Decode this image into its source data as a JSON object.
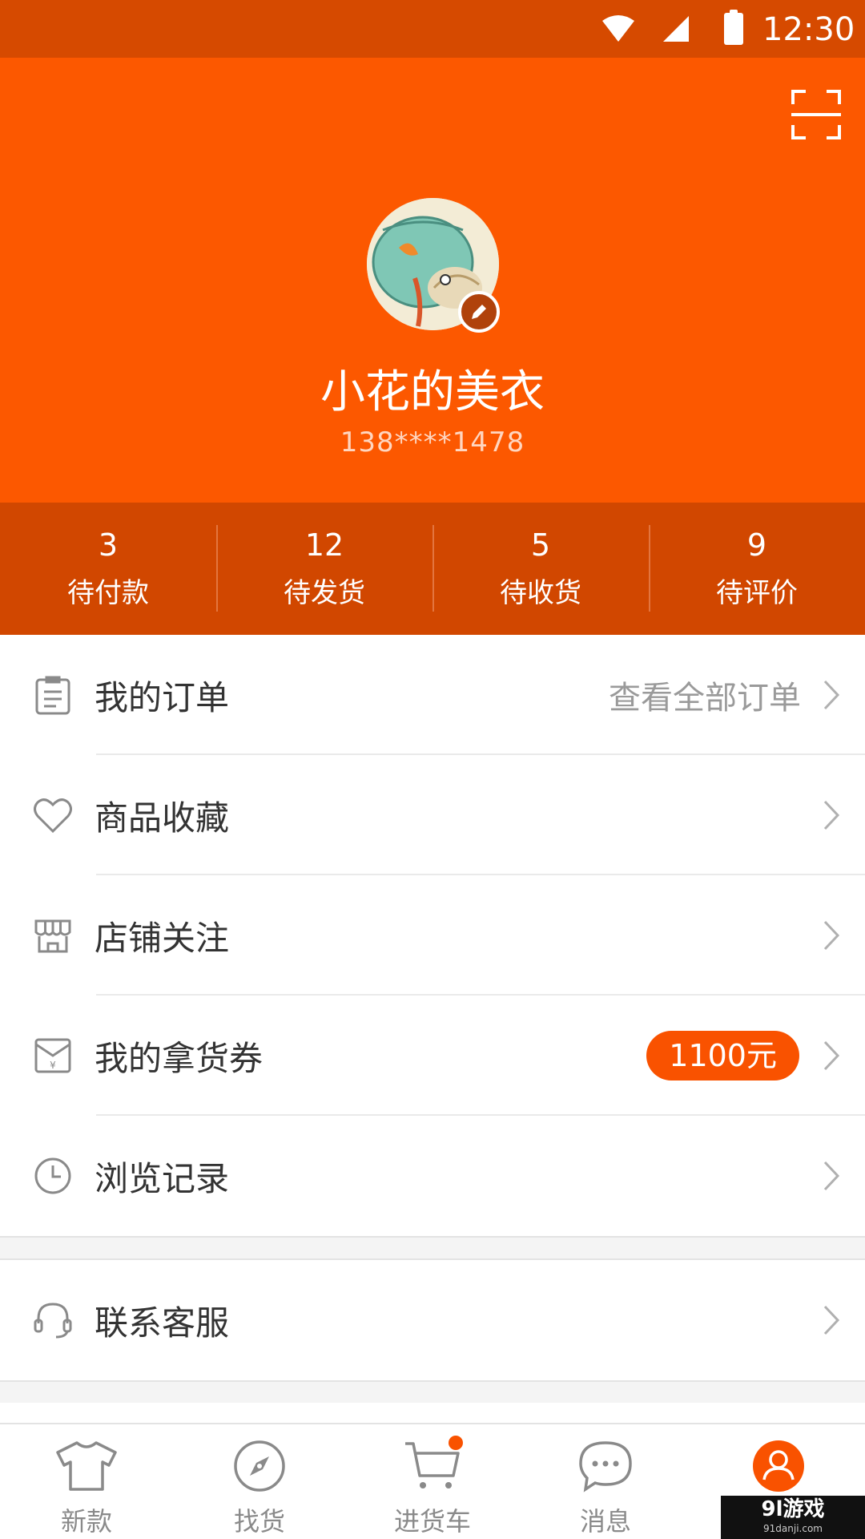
{
  "status_bar": {
    "time": "12:30"
  },
  "profile": {
    "name": "小花的美衣",
    "phone": "138****1478"
  },
  "order_stats": [
    {
      "count": "3",
      "label": "待付款"
    },
    {
      "count": "12",
      "label": "待发货"
    },
    {
      "count": "5",
      "label": "待收货"
    },
    {
      "count": "9",
      "label": "待评价"
    }
  ],
  "menu": {
    "orders": {
      "label": "我的订单",
      "right_text": "查看全部订单",
      "icon": "clipboard-icon"
    },
    "favorites": {
      "label": "商品收藏",
      "icon": "heart-icon"
    },
    "followed_shops": {
      "label": "店铺关注",
      "icon": "shop-icon"
    },
    "coupons": {
      "label": "我的拿货券",
      "badge": "1100元",
      "icon": "coupon-envelope-icon",
      "icon_text": "¥"
    },
    "history": {
      "label": "浏览记录",
      "icon": "clock-icon"
    },
    "support": {
      "label": "联系客服",
      "icon": "headset-icon"
    }
  },
  "bottom_nav": [
    {
      "label": "新款",
      "icon": "tshirt-icon"
    },
    {
      "label": "找货",
      "icon": "compass-icon"
    },
    {
      "label": "进货车",
      "icon": "cart-icon"
    },
    {
      "label": "消息",
      "icon": "chat-bubble-icon"
    },
    {
      "label": "",
      "icon": "profile-icon"
    }
  ],
  "watermark": {
    "main": "9l游戏",
    "sub": "91danji.com"
  },
  "colors": {
    "accent": "#fc5800",
    "status_bar": "#d64a00",
    "stats_bar": "#d14700",
    "badge": "#f95200"
  }
}
